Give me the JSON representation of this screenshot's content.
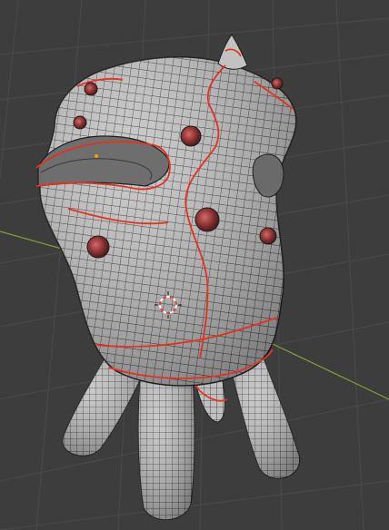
{
  "viewport": {
    "background": "#3d3d3d",
    "grid_color": "#4a4a4a",
    "x_axis_color": "#b24a4a",
    "y_axis_color": "#7fa13a"
  },
  "model": {
    "mesh_fill": "#bdbdbd",
    "wire_color": "#2f2f2f",
    "seam_color": "#e8301f",
    "nodule_color": "#9a3b3b"
  },
  "cursor": {
    "name": "3d-cursor-icon",
    "color_a": "#ffffff",
    "color_b": "#e03c3c"
  },
  "origin_marker": {
    "color": "#f39c12"
  }
}
